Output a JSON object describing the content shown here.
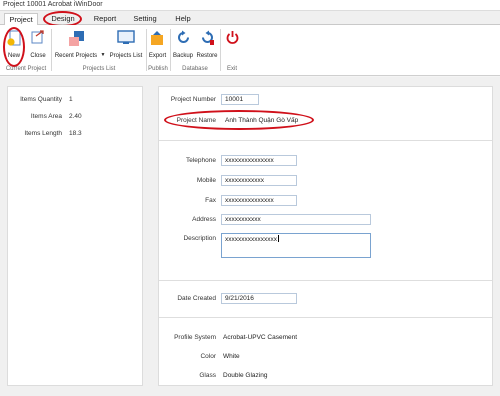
{
  "window": {
    "title": "Project 10001  Acrobat iWinDoor"
  },
  "menu": {
    "tabs": [
      "Project",
      "Design",
      "Report",
      "Setting",
      "Help"
    ]
  },
  "ribbon": {
    "new": "New",
    "close": "Close",
    "recent_projects": "Recent Projects",
    "projects_list": "Projects List",
    "export": "Export",
    "backup": "Backup",
    "restore": "Restore",
    "exit": "Exit",
    "groups": {
      "current_project": "Current Project",
      "projects_list": "Projects List",
      "publish": "Publish",
      "database": "Database",
      "exit": "Exit"
    }
  },
  "summary": {
    "items_quantity_label": "Items Quantity",
    "items_quantity": "1",
    "items_area_label": "Items Area",
    "items_area": "2.40",
    "items_length_label": "Items Length",
    "items_length": "18.3"
  },
  "form": {
    "project_number_label": "Project Number",
    "project_number": "10001",
    "project_name_label": "Project Name",
    "project_name": "Anh Thành Quận Gò Vấp",
    "telephone_label": "Telephone",
    "telephone": "xxxxxxxxxxxxxxx",
    "mobile_label": "Mobile",
    "mobile": "xxxxxxxxxxxx",
    "fax_label": "Fax",
    "fax": "xxxxxxxxxxxxxxx",
    "address_label": "Address",
    "address": "xxxxxxxxxxx",
    "description_label": "Description",
    "description": "xxxxxxxxxxxxxxxx",
    "date_created_label": "Date Created",
    "date_created": "9/21/2016",
    "profile_system_label": "Profile System",
    "profile_system": "Acrobat-UPVC Casement",
    "color_label": "Color",
    "color": "White",
    "glass_label": "Glass",
    "glass": "Double Glazing"
  },
  "colors": {
    "highlight": "#d0101a",
    "accent": "#2e6db4"
  }
}
